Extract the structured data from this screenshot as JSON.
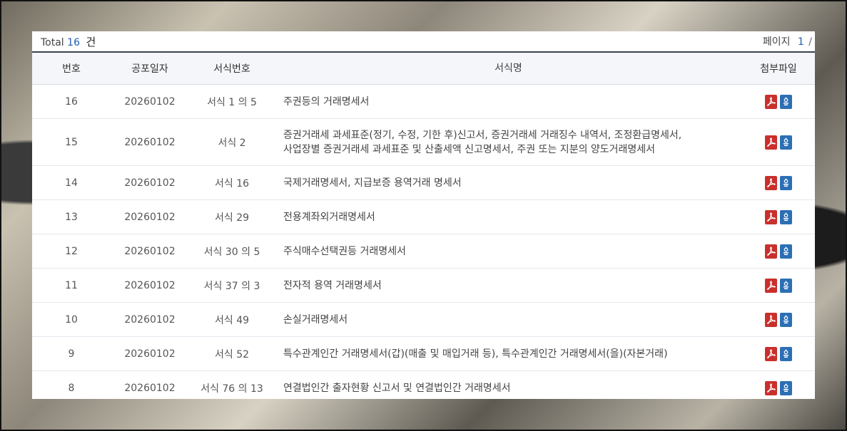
{
  "summary": {
    "total_label": "Total",
    "total_count": "16",
    "total_unit": "건",
    "page_label": "페이지",
    "page_current": "1",
    "page_sep": "/"
  },
  "table": {
    "headers": {
      "no": "번호",
      "date": "공포일자",
      "form": "서식번호",
      "name": "서식명",
      "file": "첨부파일"
    },
    "rows": [
      {
        "no": "16",
        "date": "20260102",
        "form": "서식 1 의 5",
        "name": "주권등의 거래명세서"
      },
      {
        "no": "15",
        "date": "20260102",
        "form": "서식 2",
        "name": "증권거래세 과세표준(정기, 수정, 기한 후)신고서, 증권거래세 거래징수 내역서, 조정환급명세서,",
        "name2": "사업장별 증권거래세 과세표준 및 산출세액 신고명세서, 주권 또는 지분의 양도거래명세서"
      },
      {
        "no": "14",
        "date": "20260102",
        "form": "서식 16",
        "name": "국제거래명세서, 지급보증 용역거래 명세서"
      },
      {
        "no": "13",
        "date": "20260102",
        "form": "서식 29",
        "name": "전용계좌외거래명세서"
      },
      {
        "no": "12",
        "date": "20260102",
        "form": "서식 30 의 5",
        "name": "주식매수선택권등 거래명세서"
      },
      {
        "no": "11",
        "date": "20260102",
        "form": "서식 37 의 3",
        "name": "전자적 용역 거래명세서"
      },
      {
        "no": "10",
        "date": "20260102",
        "form": "서식 49",
        "name": "손실거래명세서"
      },
      {
        "no": "9",
        "date": "20260102",
        "form": "서식 52",
        "name": "특수관계인간 거래명세서(갑)(매출 및 매입거래 등), 특수관계인간 거래명세서(을)(자본거래)"
      },
      {
        "no": "8",
        "date": "20260102",
        "form": "서식 76 의 13",
        "name": "연결법인간 출자현황 신고서 및 연결법인간 거래명세서"
      }
    ]
  },
  "icons": {
    "pdf": "pdf-file-icon",
    "hwp": "hwp-file-icon"
  },
  "colors": {
    "accent": "#1f5bb5",
    "pdf": "#c9302c",
    "hwp": "#2c6fb5",
    "header_bg": "#f4f6fa"
  }
}
